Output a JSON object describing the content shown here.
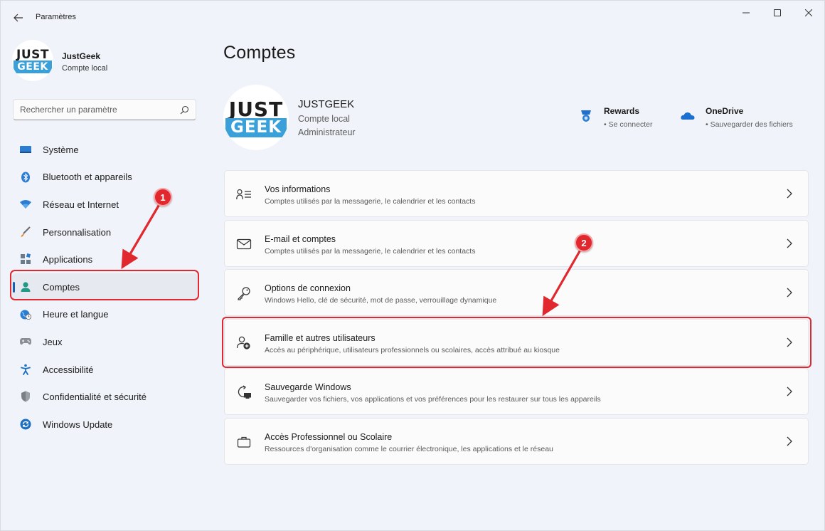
{
  "window": {
    "title": "Paramètres",
    "controls": {
      "minimize": "—",
      "close": "✕"
    }
  },
  "sidebar": {
    "profile": {
      "logo_top": "JUST",
      "logo_bottom": "GEEK",
      "name": "JustGeek",
      "type": "Compte local"
    },
    "search": {
      "placeholder": "Rechercher un paramètre"
    },
    "items": [
      {
        "label": "Système",
        "icon": "system-icon"
      },
      {
        "label": "Bluetooth et appareils",
        "icon": "bluetooth-icon"
      },
      {
        "label": "Réseau et Internet",
        "icon": "wifi-icon"
      },
      {
        "label": "Personnalisation",
        "icon": "brush-icon"
      },
      {
        "label": "Applications",
        "icon": "apps-icon"
      },
      {
        "label": "Comptes",
        "icon": "person-icon",
        "selected": true
      },
      {
        "label": "Heure et langue",
        "icon": "globe-clock-icon"
      },
      {
        "label": "Jeux",
        "icon": "gamepad-icon"
      },
      {
        "label": "Accessibilité",
        "icon": "accessibility-icon"
      },
      {
        "label": "Confidentialité et sécurité",
        "icon": "shield-icon"
      },
      {
        "label": "Windows Update",
        "icon": "update-icon"
      }
    ]
  },
  "main": {
    "title": "Comptes",
    "profile": {
      "logo_top": "JUST",
      "logo_bottom": "GEEK",
      "name": "JUSTGEEK",
      "line1": "Compte local",
      "line2": "Administrateur"
    },
    "services": [
      {
        "title": "Rewards",
        "sub": "• Se connecter",
        "icon": "rewards-icon"
      },
      {
        "title": "OneDrive",
        "sub": "• Sauvegarder des fichiers",
        "icon": "onedrive-icon"
      }
    ],
    "cards": [
      {
        "title": "Vos informations",
        "desc": "Comptes utilisés par la messagerie, le calendrier et les contacts",
        "icon": "person-info-icon"
      },
      {
        "title": "E-mail et comptes",
        "desc": "Comptes utilisés par la messagerie, le calendrier et les contacts",
        "icon": "mail-icon"
      },
      {
        "title": "Options de connexion",
        "desc": "Windows Hello, clé de sécurité, mot de passe, verrouillage dynamique",
        "icon": "key-icon"
      },
      {
        "title": "Famille et autres utilisateurs",
        "desc": "Accès au périphérique, utilisateurs professionnels ou scolaires, accès attribué au kiosque",
        "icon": "person-add-icon"
      },
      {
        "title": "Sauvegarde Windows",
        "desc": "Sauvegarder vos fichiers, vos applications et vos préférences pour les restaurer sur tous les appareils",
        "icon": "backup-icon"
      },
      {
        "title": "Accès Professionnel ou Scolaire",
        "desc": "Ressources d'organisation comme le courrier électronique, les applications et le réseau",
        "icon": "briefcase-icon"
      }
    ]
  },
  "annotations": {
    "marker1": "1",
    "marker2": "2",
    "color": "#e0282e"
  },
  "colors": {
    "accent": "#1a5fb4",
    "window_bg": "#f0f3f9",
    "card_bg": "#fbfbfc",
    "logo_blue": "#3aa0d9"
  }
}
